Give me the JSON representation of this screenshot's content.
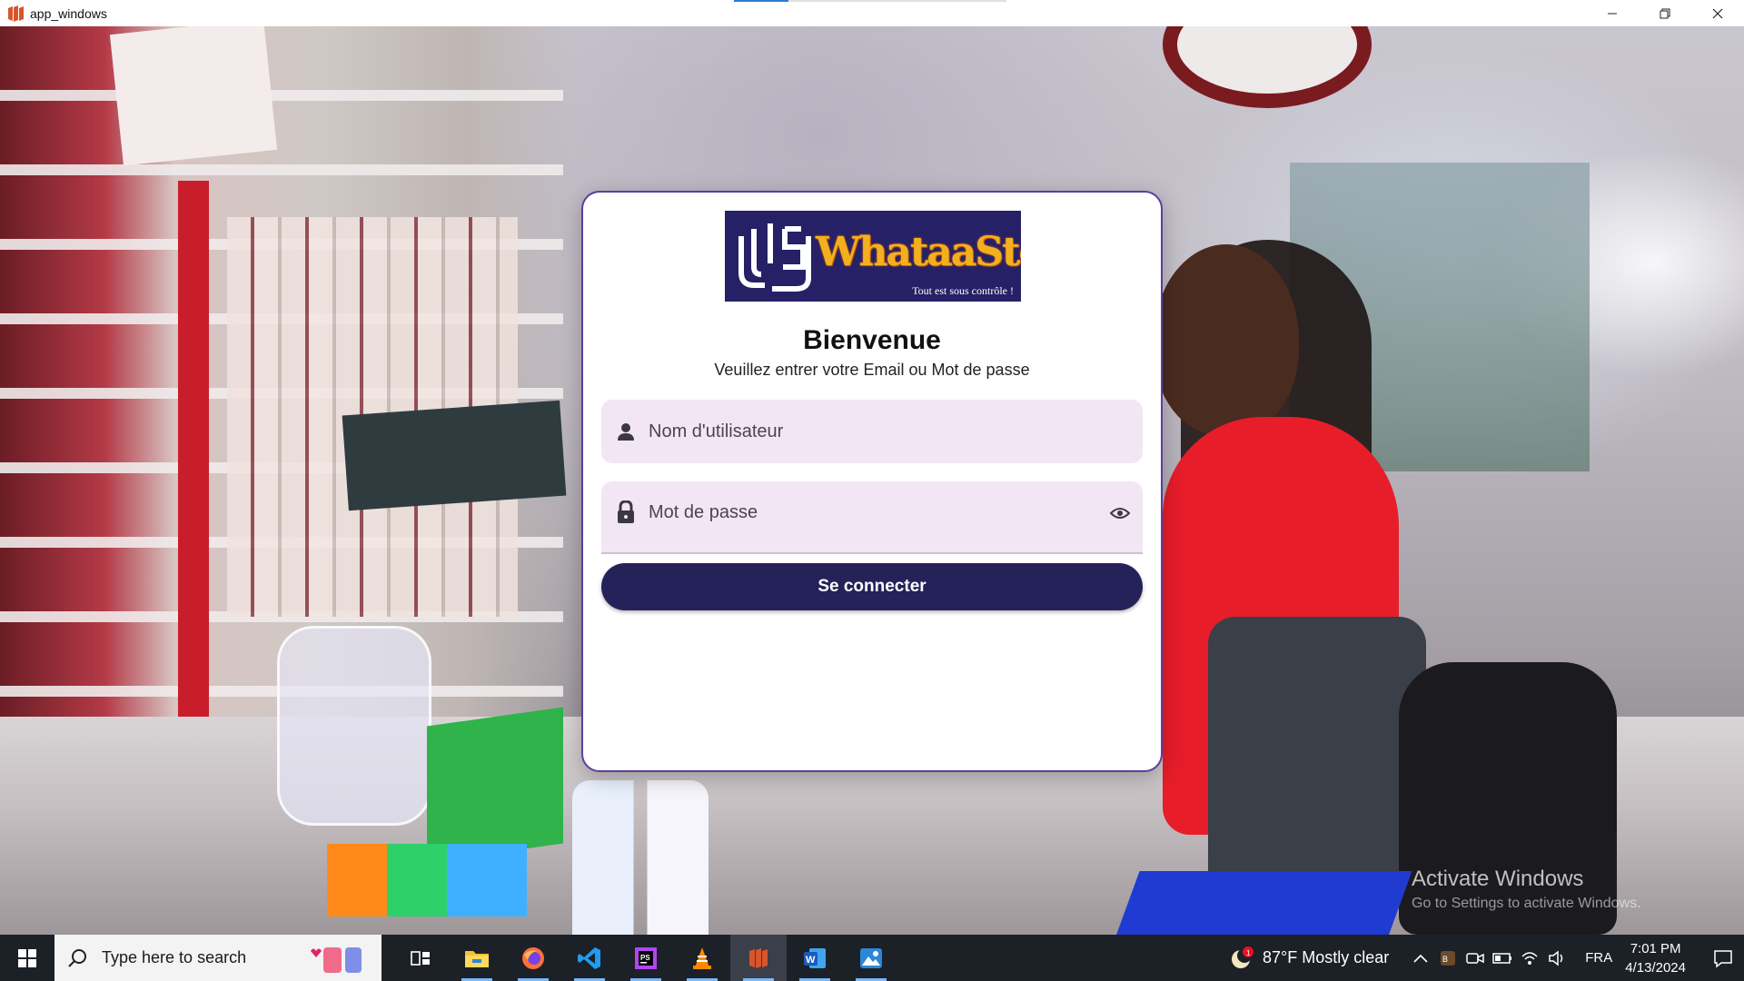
{
  "window": {
    "title": "app_windows"
  },
  "login": {
    "brand": "WhataaStock",
    "tagline": "Tout est sous contrôle !",
    "welcome": "Bienvenue",
    "subtitle": "Veuillez entrer votre Email ou Mot de passe",
    "username_placeholder": "Nom d'utilisateur",
    "password_placeholder": "Mot de passe",
    "submit_label": "Se connecter"
  },
  "watermark": {
    "line1": "Activate Windows",
    "line2": "Go to Settings to activate Windows."
  },
  "taskbar": {
    "search_placeholder": "Type here to search",
    "apps": [
      {
        "name": "task-view-icon"
      },
      {
        "name": "file-explorer-icon"
      },
      {
        "name": "firefox-icon"
      },
      {
        "name": "vscode-icon"
      },
      {
        "name": "phpstorm-icon"
      },
      {
        "name": "vlc-icon"
      },
      {
        "name": "app-windows-icon"
      },
      {
        "name": "word-icon"
      },
      {
        "name": "photos-icon"
      }
    ],
    "weather_text": "87°F  Mostly clear",
    "language": "FRA",
    "time": "7:01 PM",
    "date": "4/13/2024",
    "colors": {
      "taskbar_bg": "#1c2027",
      "button_bg": "#252259",
      "field_bg": "#f3e6f4"
    }
  }
}
